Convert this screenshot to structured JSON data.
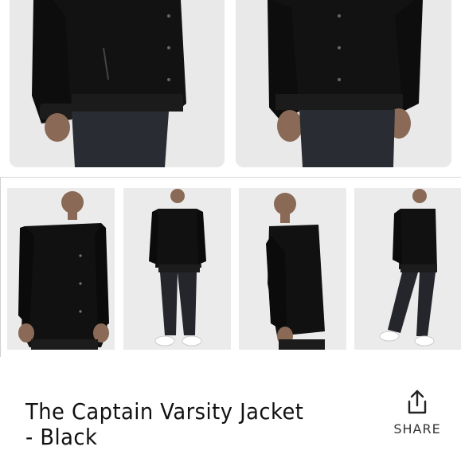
{
  "product": {
    "title": "The Captain Varsity Jacket - Black"
  },
  "share": {
    "label": "SHARE",
    "icon": "share-icon"
  },
  "gallery": {
    "hero_images": [
      "model-jacket-front-closeup",
      "model-jacket-side-closeup"
    ],
    "thumbnails": [
      "model-front-view",
      "model-full-body-front",
      "model-side-view",
      "model-full-body-walking"
    ]
  },
  "colors": {
    "jacket": "#111111",
    "image_background": "#ebebeb",
    "text": "#111111"
  }
}
